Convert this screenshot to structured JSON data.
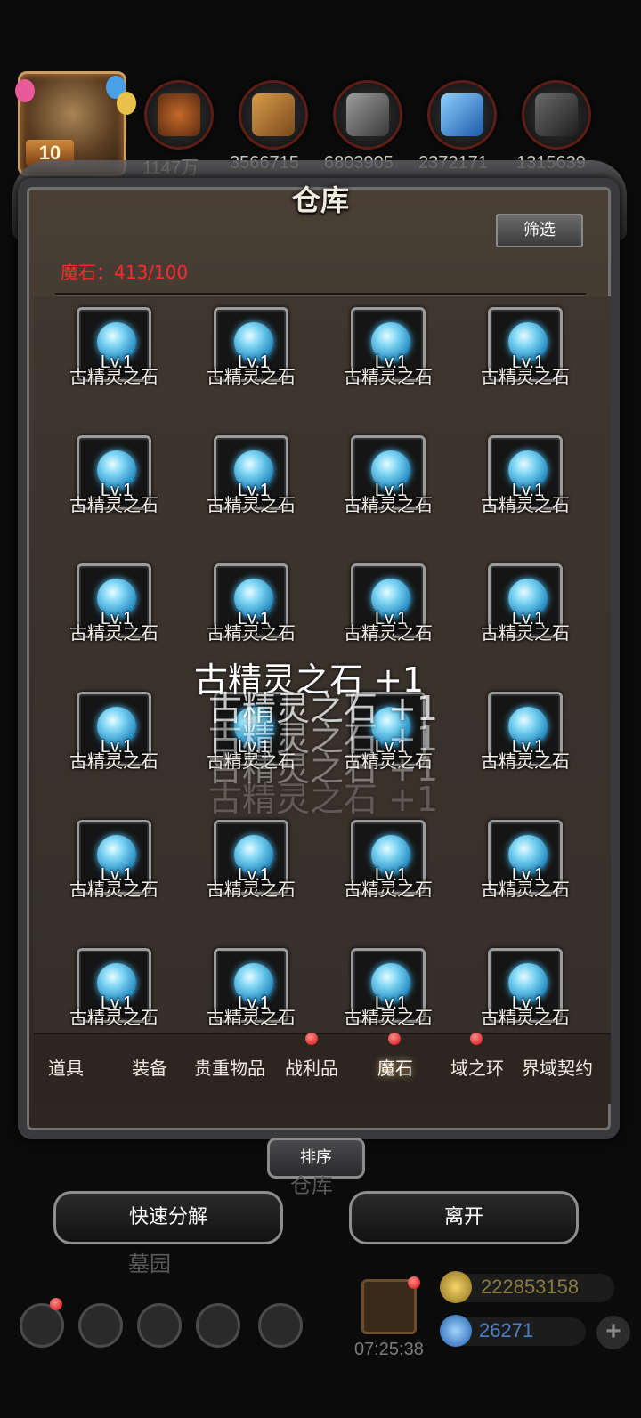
{
  "resources": {
    "level": "10",
    "values": [
      "1147万",
      "3566715",
      "6803905",
      "2372171",
      "1315639"
    ]
  },
  "panel": {
    "title": "仓库",
    "filter_label": "筛选",
    "demon_stone_count": "魔石：413/100"
  },
  "items": [
    {
      "level": "Lv.1",
      "name": "古精灵之石"
    }
  ],
  "item_rows": 6,
  "float_texts": [
    "古精灵之石 +1",
    "古精灵之石 +1",
    "古精灵之石 +1",
    "古精灵之石 +1",
    "古精灵之石 +1"
  ],
  "tabs": [
    {
      "label": "道具",
      "dot": false
    },
    {
      "label": "装备",
      "dot": false
    },
    {
      "label": "贵重物品",
      "dot": false
    },
    {
      "label": "战利品",
      "dot": true
    },
    {
      "label": "魔石",
      "dot": true,
      "active": true
    },
    {
      "label": "域之环",
      "dot": true
    },
    {
      "label": "界域契约",
      "dot": false
    }
  ],
  "sort_label": "排序",
  "background_labels": {
    "warehouse": "仓库",
    "graveyard": "墓园"
  },
  "buttons": {
    "quick_decompose": "快速分解",
    "leave": "离开"
  },
  "bottom": {
    "timer": "07:25:38",
    "gold": "222853158",
    "diamonds": "26271"
  },
  "colors": {
    "demon_count": "#ff2a2a",
    "notification_dot": "#d20d0d",
    "gold_text": "#8a7a40",
    "diamond_text": "#4a7ec2"
  }
}
